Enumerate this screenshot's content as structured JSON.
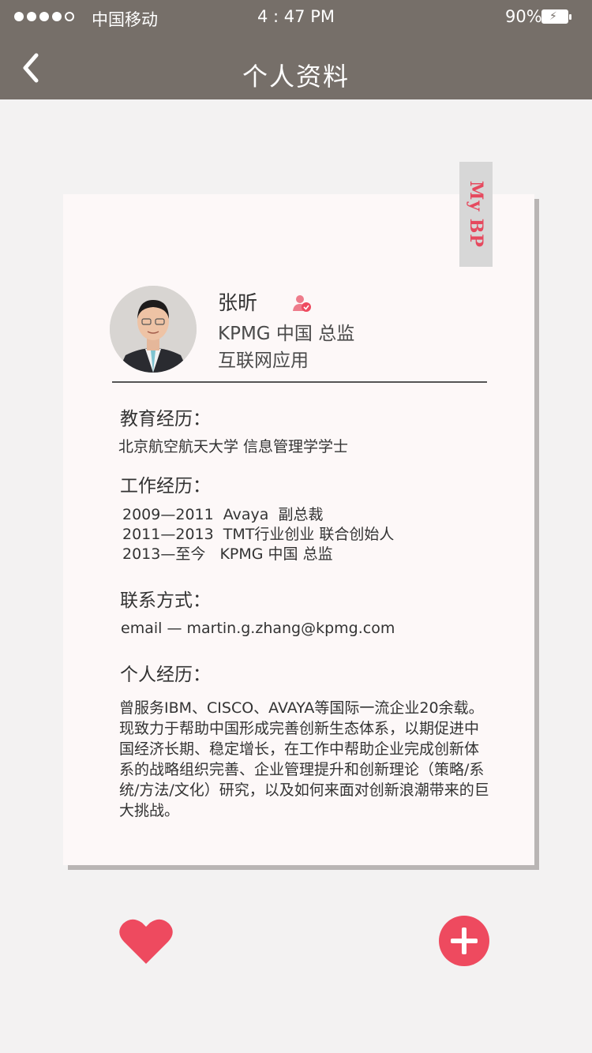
{
  "status_bar": {
    "carrier": "中国移动",
    "time": "4 : 47 PM",
    "battery": "90%"
  },
  "header": {
    "title": "个人资料"
  },
  "card": {
    "tab_label": "My BP",
    "name": "张昕",
    "role": "KPMG 中国 总监",
    "field": "互联网应用",
    "education_title": "教育经历：",
    "education": "北京航空航天大学 信息管理学学士",
    "work_title": "工作经历：",
    "work": [
      "2009—2011  Avaya  副总裁",
      "2011—2013  TMT行业创业 联合创始人",
      "2013—至今   KPMG 中国 总监"
    ],
    "contact_title": "联系方式：",
    "contact": "email — martin.g.zhang@kpmg.com",
    "bio_title": "个人经历：",
    "bio": "曾服务IBM、CISCO、AVAYA等国际一流企业20余载。现致力于帮助中国形成完善创新生态体系，以期促进中国经济长期、稳定增长，在工作中帮助企业完成创新体系的战略组织完善、企业管理提升和创新理论（策略/系统/方法/文化）研究，以及如何来面对创新浪潮带来的巨大挑战。"
  },
  "colors": {
    "header_bg": "#766f69",
    "accent": "#ee4a5f",
    "card_bg": "#fdf8f8"
  }
}
